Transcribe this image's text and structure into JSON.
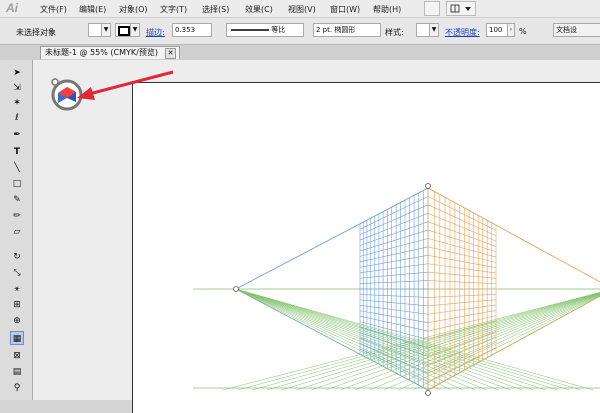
{
  "app": {
    "logo": "Ai"
  },
  "menu": [
    "文件(F)",
    "编辑(E)",
    "对象(O)",
    "文字(T)",
    "选择(S)",
    "效果(C)",
    "视图(V)",
    "窗口(W)",
    "帮助(H)"
  ],
  "control_bar": {
    "selection_status": "未选择对象",
    "stroke_label": "描边:",
    "stroke_value": "0.353",
    "stroke_profile": "等比",
    "brush": "2 pt. 椭圆形",
    "style_label": "样式:",
    "opacity_label": "不透明度:",
    "opacity_value": "100",
    "opacity_unit": "%",
    "doc_settings": "文档设"
  },
  "document_tab": {
    "title": "未标题-1 @ 55% (CMYK/预览)",
    "close": "✕"
  },
  "colors": {
    "left_plane": "#6f9fe0",
    "right_plane": "#f0a15a",
    "ground": "#7fc46b",
    "arrow": "#e0283a"
  },
  "tools": [
    "selection-icon",
    "direct-selection-icon",
    "magic-wand-icon",
    "lasso-icon",
    "pen-icon",
    "type-icon",
    "line-segment-icon",
    "rectangle-icon",
    "paintbrush-icon",
    "pencil-icon",
    "eraser-icon",
    "rotate-icon",
    "scale-icon",
    "width-icon",
    "free-transform-icon",
    "shape-builder-icon",
    "perspective-grid-icon",
    "mesh-icon",
    "gradient-icon",
    "eyedropper-icon"
  ]
}
